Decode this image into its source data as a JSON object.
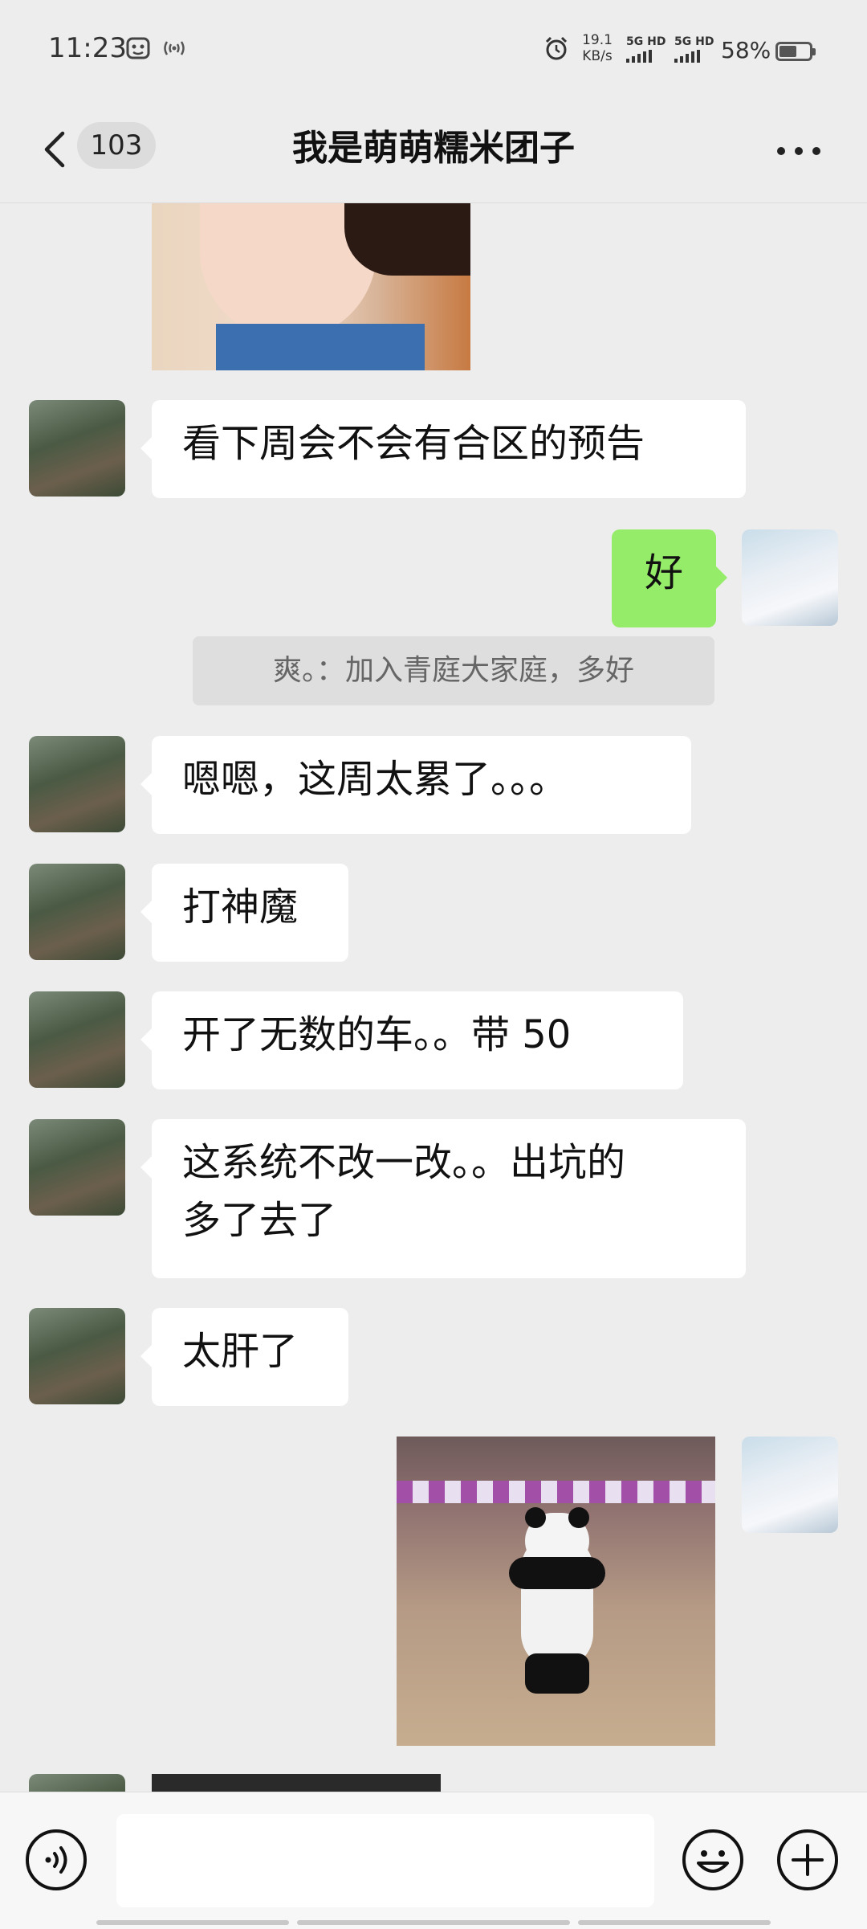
{
  "status_bar": {
    "time": "11:23",
    "net_speed_value": "19.1",
    "net_speed_unit": "KB/s",
    "sim1_label": "5G HD",
    "sim2_label": "5G HD",
    "battery_text": "58%",
    "battery_level": 0.58,
    "icons": [
      "screen-record-icon",
      "hotspot-icon",
      "alarm-icon",
      "signal-icon",
      "battery-icon"
    ]
  },
  "nav": {
    "unread_count": "103",
    "title": "我是萌萌糯米团子",
    "icons": [
      "back-chevron-icon",
      "more-dots-icon"
    ]
  },
  "messages": [
    {
      "type": "image",
      "side": "left",
      "subject": "baby photo"
    },
    {
      "type": "text",
      "side": "left",
      "text": "看下周会不会有合区的预告"
    },
    {
      "type": "text",
      "side": "right",
      "text": "好"
    },
    {
      "type": "system",
      "text": "爽。：加入青庭大家庭，多好"
    },
    {
      "type": "text",
      "side": "left",
      "text": "嗯嗯，这周太累了。。。"
    },
    {
      "type": "text",
      "side": "left",
      "text": "打神魔"
    },
    {
      "type": "text",
      "side": "left",
      "text": "开了无数的车。。带 50"
    },
    {
      "type": "text",
      "side": "left",
      "text": "这系统不改一改。。出坑的\n多了去了"
    },
    {
      "type": "text",
      "side": "left",
      "text": "太肝了"
    },
    {
      "type": "image",
      "side": "right",
      "subject": "panda costume in mall"
    },
    {
      "type": "image",
      "side": "left",
      "subject": "dark image (partially visible)"
    }
  ],
  "input_bar": {
    "placeholder": "",
    "icons": [
      "voice-icon",
      "emoji-icon",
      "plus-icon"
    ]
  },
  "colors": {
    "background": "#ededed",
    "bubble_self": "#95ec69",
    "bubble_other": "#ffffff",
    "system_bg": "#dedede"
  }
}
